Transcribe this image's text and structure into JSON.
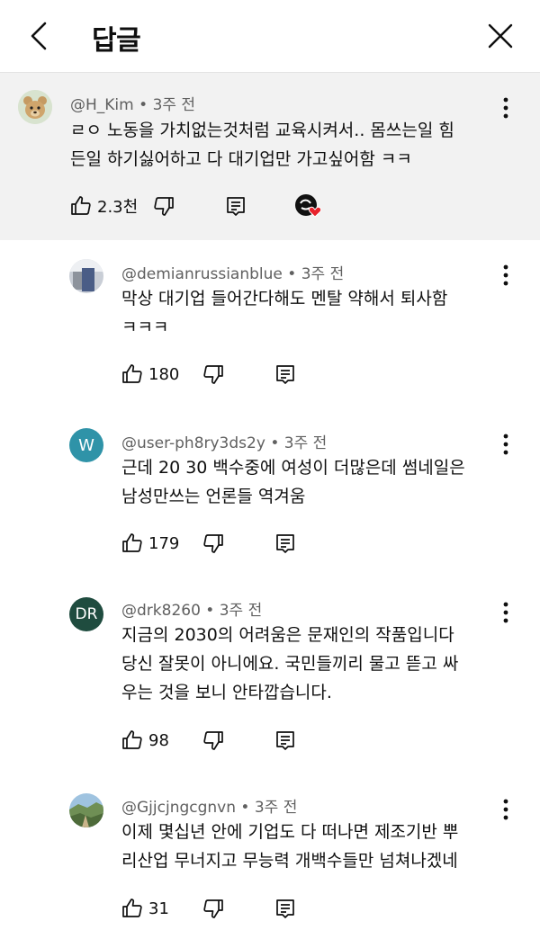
{
  "header": {
    "title": "답글"
  },
  "parent": {
    "author": "@H_Kim",
    "time": "3주 전",
    "lines": [
      "ㄹㅇ 노동을 가치없는것처럼 교육시켜서.. 몸쓰는일 힘",
      "든일 하기싫어하고 다 대기업만 가고싶어함 ㅋㅋ"
    ],
    "likes": "2.3천"
  },
  "replies": [
    {
      "author": "@demianrussianblue",
      "time": "3주 전",
      "lines": [
        "막상 대기업 들어간다해도 멘탈 약해서 퇴사함",
        "ㅋㅋㅋ"
      ],
      "likes": "180"
    },
    {
      "author": "@user-ph8ry3ds2y",
      "time": "3주 전",
      "avatar_text": "W",
      "lines": [
        "근데 20 30 백수중에 여성이 더많은데 썸네일은",
        "남성만쓰는 언론들 역겨움"
      ],
      "likes": "179"
    },
    {
      "author": "@drk8260",
      "time": "3주 전",
      "avatar_text": "DR",
      "lines": [
        "지금의 2030의 어려움은 문재인의 작품입니다",
        "당신 잘못이 아니에요. 국민들끼리 물고 뜯고 싸",
        "우는 것을 보니 안타깝습니다."
      ],
      "likes": "98"
    },
    {
      "author": "@Gjjcjngcgnvn",
      "time": "3주 전",
      "lines": [
        "이제 몇십년 안에 기업도 다 떠나면 제조기반 뿌",
        "리산업 무너지고 무능력 개백수들만 넘쳐나겠네"
      ],
      "likes": "31"
    }
  ],
  "colors": {
    "avatar_w": "#2f93a8",
    "avatar_dr": "#1f4c3f",
    "heart": "#e8222b"
  }
}
